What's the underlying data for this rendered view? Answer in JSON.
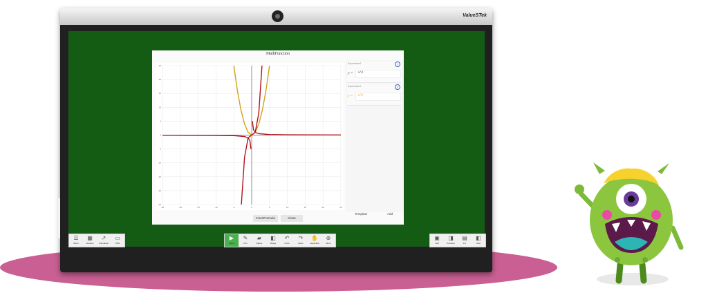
{
  "screen": {
    "brand": "ValueSTek",
    "board_color": "#145c14",
    "floor_color": "#c95f93"
  },
  "dialog": {
    "title": "MathFunction",
    "insert_label": "InsertFormula",
    "close_label": "Close",
    "template_label": "Template",
    "add_label": "Add",
    "expressions": [
      {
        "label": "Expression2",
        "prefix": "y =",
        "value": "x^3",
        "color": "#b0121b"
      },
      {
        "label": "Expression1",
        "prefix": "y =",
        "value": "x^2",
        "color": "#d4a017"
      }
    ]
  },
  "chart_data": {
    "type": "line",
    "xlim": [
      -25,
      25
    ],
    "ylim": [
      -25,
      25
    ],
    "x_ticks": [
      -25,
      -20,
      -15,
      -10,
      -5,
      0,
      5,
      10,
      15,
      20,
      25
    ],
    "y_ticks": [
      25,
      20,
      15,
      10,
      5,
      0,
      -5,
      -10,
      -15,
      -20,
      -25
    ],
    "grid": true,
    "series": [
      {
        "name": "Expression1",
        "color": "#d4a017",
        "expression": "y = x^2",
        "x": [
          -5,
          -4,
          -3,
          -2,
          -1,
          0,
          1,
          2,
          3,
          4,
          5
        ],
        "y": [
          25,
          16,
          9,
          4,
          1,
          0,
          1,
          4,
          9,
          16,
          25
        ]
      },
      {
        "name": "Expression2",
        "color": "#b0121b",
        "expression": "y = x^3",
        "x": [
          -3,
          -2,
          -1,
          0,
          1,
          2,
          3
        ],
        "y": [
          -27,
          -8,
          -1,
          0,
          1,
          8,
          27
        ]
      },
      {
        "name": "",
        "color": "#b0121b",
        "expression": "",
        "x": [
          -25,
          -10,
          -5,
          -2,
          -1,
          -0.5,
          -0.2,
          0.2,
          0.5,
          1,
          2,
          5,
          10,
          25
        ],
        "y": [
          -0.04,
          -0.1,
          -0.2,
          -0.5,
          -1,
          -2,
          -5,
          5,
          2,
          1,
          0.5,
          0.2,
          0.1,
          0.04
        ]
      }
    ]
  },
  "taskbar": {
    "left": [
      {
        "label": "Menu",
        "icon": "menu-icon",
        "glyph": "☰"
      },
      {
        "label": "Desktop",
        "icon": "desktop-icon",
        "glyph": "▦"
      },
      {
        "label": "Annotation",
        "icon": "annotation-icon",
        "glyph": "↗"
      },
      {
        "label": "OSD",
        "icon": "osd-icon",
        "glyph": "▭"
      }
    ],
    "center": [
      {
        "label": "Select",
        "icon": "cursor-icon",
        "glyph": "▶",
        "active": true
      },
      {
        "label": "Pen",
        "icon": "pen-icon",
        "glyph": "✎"
      },
      {
        "label": "Delete",
        "icon": "eraser-icon",
        "glyph": "▰"
      },
      {
        "label": "Shape",
        "icon": "shape-icon",
        "glyph": "◧"
      },
      {
        "label": "Undo",
        "icon": "undo-icon",
        "glyph": "↶"
      },
      {
        "label": "Redo",
        "icon": "redo-icon",
        "glyph": "↷"
      },
      {
        "label": "InkedNote",
        "icon": "hand-icon",
        "glyph": "✋"
      },
      {
        "label": "More",
        "icon": "more-icon",
        "glyph": "⊕"
      }
    ],
    "right": [
      {
        "label": "Add",
        "icon": "add-page-icon",
        "glyph": "▣"
      },
      {
        "label": "Previous",
        "icon": "previous-icon",
        "glyph": "◨"
      },
      {
        "label": "1/1",
        "icon": "pages-icon",
        "glyph": "▤"
      },
      {
        "label": "Next",
        "icon": "next-icon",
        "glyph": "◧"
      }
    ]
  }
}
